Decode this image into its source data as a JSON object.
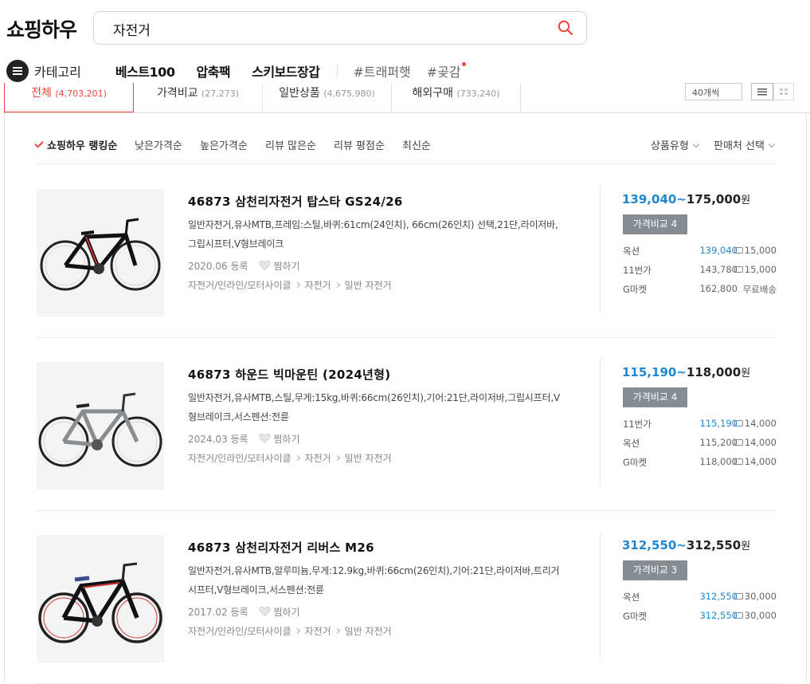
{
  "header": {
    "logo": "쇼핑하우",
    "search_value": "자전거"
  },
  "nav": {
    "category": "카테고리",
    "items": [
      "베스트100",
      "압축팩",
      "스키보드장갑"
    ],
    "tags": [
      "#트래퍼햇",
      "#곶감"
    ]
  },
  "tabs": [
    {
      "label": "전체",
      "count": "(4,703,201)"
    },
    {
      "label": "가격비교",
      "count": "(27,273)"
    },
    {
      "label": "일반상품",
      "count": "(4,675,980)"
    },
    {
      "label": "해외구매",
      "count": "(733,240)"
    }
  ],
  "count_select": "40개씩",
  "sort": {
    "options": [
      "쇼핑하우 랭킹순",
      "낮은가격순",
      "높은가격순",
      "리뷰 많은순",
      "리뷰 평점순",
      "최신순"
    ],
    "filter_type": "상품유형",
    "filter_seller": "판매처 선택"
  },
  "products": [
    {
      "name": "46873 삼천리자전거 탑스타 GS24/26",
      "spec": "일반자전거,유사MTB,프레임:스틸,바퀴:61cm(24인치), 66cm(26인치) 선택,21단,라이저바,그립시프터,V형브레이크",
      "date": "2020.06 등록",
      "like": "찜하기",
      "categories": [
        "자전거/인라인/모터사이클",
        "자전거",
        "일반 자전거"
      ],
      "price_min": "139,040",
      "price_max": "175,000",
      "won": "원",
      "compare": "가격비교 4",
      "malls": [
        {
          "name": "옥션",
          "price": "139,040",
          "ship": "15,000",
          "best": true
        },
        {
          "name": "11번가",
          "price": "143,780",
          "ship": "15,000",
          "best": false
        },
        {
          "name": "G마켓",
          "price": "162,800",
          "ship": "무료배송",
          "best": false
        }
      ]
    },
    {
      "name": "46873 하운드 빅마운틴 (2024년형)",
      "spec": "일반자전거,유사MTB,스틸,무게:15kg,바퀴:66cm(26인치),기어:21단,라이저바,그립시프터,V형브레이크,서스펜션:전륜",
      "date": "2024.03 등록",
      "like": "찜하기",
      "categories": [
        "자전거/인라인/모터사이클",
        "자전거",
        "일반 자전거"
      ],
      "price_min": "115,190",
      "price_max": "118,000",
      "won": "원",
      "compare": "가격비교 4",
      "malls": [
        {
          "name": "11번가",
          "price": "115,190",
          "ship": "14,000",
          "best": true
        },
        {
          "name": "옥션",
          "price": "115,200",
          "ship": "14,000",
          "best": false
        },
        {
          "name": "G마켓",
          "price": "118,000",
          "ship": "14,000",
          "best": false
        }
      ]
    },
    {
      "name": "46873 삼천리자전거 리버스 M26",
      "spec": "일반자전거,유사MTB,알루미늄,무게:12.9kg,바퀴:66cm(26인치),기어:21단,라이저바,트리거시프터,V형브레이크,서스펜션:전륜",
      "date": "2017.02 등록",
      "like": "찜하기",
      "categories": [
        "자전거/인라인/모터사이클",
        "자전거",
        "일반 자전거"
      ],
      "price_min": "312,550",
      "price_max": "312,550",
      "won": "원",
      "compare": "가격비교 3",
      "malls": [
        {
          "name": "옥션",
          "price": "312,550",
          "ship": "30,000",
          "best": true
        },
        {
          "name": "G마켓",
          "price": "312,550",
          "ship": "30,000",
          "best": true
        }
      ]
    }
  ],
  "colors": {
    "accent": "#f0483e",
    "price_blue": "#1e88d2",
    "compare_btn": "#858c92"
  }
}
